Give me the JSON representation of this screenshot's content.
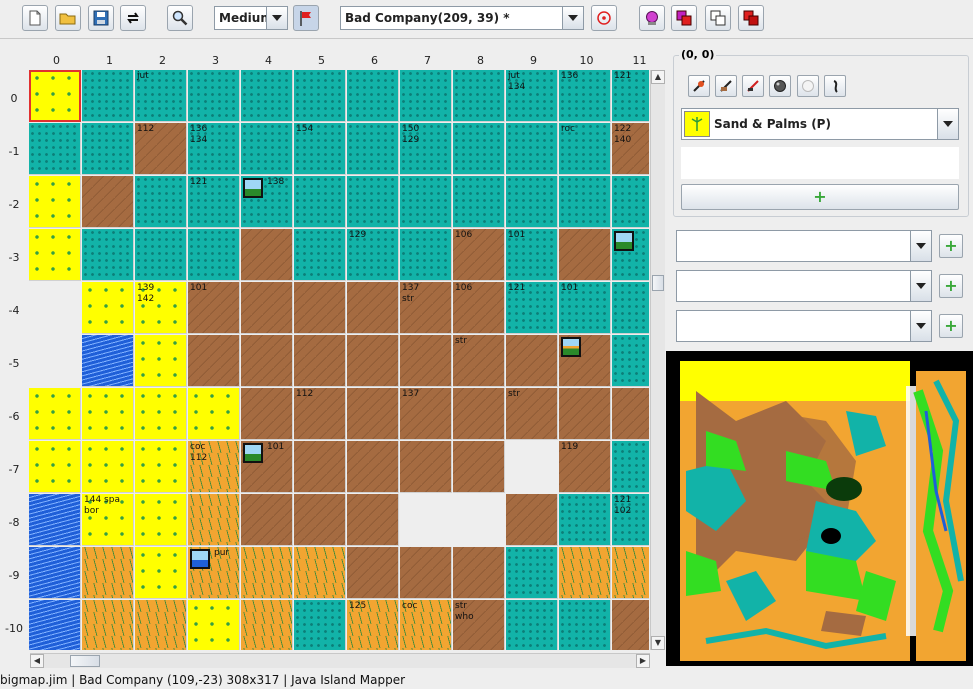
{
  "toolbar": {
    "icons": [
      "new-file-icon",
      "open-folder-icon",
      "save-icon",
      "swap-icon",
      "magnify-icon"
    ],
    "zoom_value": "Medium",
    "flag_icon": "flag-icon",
    "player_value": "Bad Company(209, 39) *",
    "target_icon": "target-icon",
    "right_icons": [
      "palette-icon",
      "layers-icon",
      "copy-layers-icon",
      "fill-icon"
    ]
  },
  "map": {
    "col_headers": [
      "0",
      "1",
      "2",
      "3",
      "4",
      "5",
      "6",
      "7",
      "8",
      "9",
      "10",
      "11"
    ],
    "row_headers": [
      "0",
      "-1",
      "-2",
      "-3",
      "-4",
      "-5",
      "-6",
      "-7",
      "-8",
      "-9",
      "-10"
    ],
    "rows": [
      [
        "sand",
        "water",
        "water",
        "water",
        "water",
        "water",
        "water",
        "water",
        "water",
        "water",
        "water",
        "water"
      ],
      [
        "water",
        "water",
        "dirt",
        "water",
        "water",
        "water",
        "water",
        "water",
        "water",
        "water",
        "water",
        "dirt"
      ],
      [
        "sand",
        "dirt",
        "water",
        "water",
        "water",
        "water",
        "water",
        "water",
        "water",
        "water",
        "water",
        "water"
      ],
      [
        "sand",
        "water",
        "water",
        "water",
        "dirt",
        "water",
        "water",
        "water",
        "dirt",
        "water",
        "dirt",
        "water"
      ],
      [
        "empty",
        "sand",
        "sand",
        "dirt",
        "dirt",
        "dirt",
        "dirt",
        "dirt",
        "dirt",
        "water",
        "water",
        "water"
      ],
      [
        "empty",
        "wave",
        "sand",
        "dirt",
        "dirt",
        "dirt",
        "dirt",
        "dirt",
        "dirt",
        "dirt",
        "dirt",
        "water"
      ],
      [
        "sand",
        "sand",
        "sand",
        "sand",
        "dirt",
        "dirt",
        "dirt",
        "dirt",
        "dirt",
        "dirt",
        "dirt",
        "dirt"
      ],
      [
        "sand",
        "sand",
        "sand",
        "orange",
        "dirt",
        "dirt",
        "dirt",
        "dirt",
        "dirt",
        "empty",
        "dirt",
        "water"
      ],
      [
        "wave",
        "sand",
        "sand",
        "orange",
        "dirt",
        "dirt",
        "dirt",
        "empty",
        "empty",
        "dirt",
        "water",
        "water"
      ],
      [
        "wave",
        "orange",
        "sand",
        "orange",
        "orange",
        "orange",
        "dirt",
        "dirt",
        "dirt",
        "water",
        "orange",
        "orange"
      ],
      [
        "wave",
        "orange",
        "orange",
        "sand",
        "orange",
        "water",
        "orange",
        "orange",
        "dirt",
        "water",
        "water",
        "dirt"
      ]
    ],
    "labels": [
      {
        "r": 0,
        "c": 2,
        "t": [
          "jut"
        ]
      },
      {
        "r": 0,
        "c": 9,
        "t": [
          "jut",
          "134"
        ]
      },
      {
        "r": 0,
        "c": 10,
        "t": [
          "136"
        ]
      },
      {
        "r": 0,
        "c": 11,
        "t": [
          "121"
        ]
      },
      {
        "r": 1,
        "c": 2,
        "t": [
          "112"
        ]
      },
      {
        "r": 1,
        "c": 3,
        "t": [
          "136",
          "134"
        ]
      },
      {
        "r": 1,
        "c": 5,
        "t": [
          "154"
        ]
      },
      {
        "r": 1,
        "c": 7,
        "t": [
          "150",
          "129"
        ]
      },
      {
        "r": 1,
        "c": 10,
        "t": [
          "roc"
        ]
      },
      {
        "r": 1,
        "c": 11,
        "t": [
          "122",
          "140"
        ]
      },
      {
        "r": 2,
        "c": 3,
        "t": [
          "121"
        ]
      },
      {
        "r": 2,
        "c": 4,
        "t": [
          "138"
        ]
      },
      {
        "r": 3,
        "c": 6,
        "t": [
          "129"
        ]
      },
      {
        "r": 3,
        "c": 8,
        "t": [
          "106"
        ]
      },
      {
        "r": 3,
        "c": 9,
        "t": [
          "101"
        ]
      },
      {
        "r": 4,
        "c": 2,
        "t": [
          "139",
          "142"
        ]
      },
      {
        "r": 4,
        "c": 3,
        "t": [
          "101"
        ]
      },
      {
        "r": 4,
        "c": 7,
        "t": [
          "137",
          "str"
        ]
      },
      {
        "r": 4,
        "c": 8,
        "t": [
          "106"
        ]
      },
      {
        "r": 4,
        "c": 9,
        "t": [
          "121"
        ]
      },
      {
        "r": 4,
        "c": 10,
        "t": [
          "101"
        ]
      },
      {
        "r": 5,
        "c": 8,
        "t": [
          "str"
        ]
      },
      {
        "r": 6,
        "c": 5,
        "t": [
          "112"
        ]
      },
      {
        "r": 6,
        "c": 7,
        "t": [
          "137"
        ]
      },
      {
        "r": 6,
        "c": 9,
        "t": [
          "str"
        ]
      },
      {
        "r": 7,
        "c": 3,
        "t": [
          "coc",
          "112"
        ]
      },
      {
        "r": 7,
        "c": 4,
        "t": [
          "101"
        ]
      },
      {
        "r": 7,
        "c": 10,
        "t": [
          "119"
        ]
      },
      {
        "r": 8,
        "c": 1,
        "t": [
          "144    spa",
          "bor"
        ]
      },
      {
        "r": 8,
        "c": 11,
        "t": [
          "121",
          "102"
        ]
      },
      {
        "r": 9,
        "c": 3,
        "t": [
          "pur"
        ]
      },
      {
        "r": 10,
        "c": 6,
        "t": [
          "125"
        ]
      },
      {
        "r": 10,
        "c": 7,
        "t": [
          "coc"
        ]
      },
      {
        "r": 10,
        "c": 8,
        "t": [
          "str",
          "who"
        ]
      }
    ],
    "objects": [
      {
        "r": 2,
        "c": 4,
        "kind": "hut"
      },
      {
        "r": 3,
        "c": 11,
        "kind": "hut"
      },
      {
        "r": 5,
        "c": 10,
        "kind": "palm-hut"
      },
      {
        "r": 7,
        "c": 4,
        "kind": "hut"
      },
      {
        "r": 9,
        "c": 3,
        "kind": "water-hut"
      }
    ]
  },
  "panel": {
    "coord": "(0, 0)",
    "tool_icons": [
      "erase-object-icon",
      "erase-terrain-icon",
      "erase-all-icon",
      "dark-sphere-icon",
      "light-sphere-icon",
      "footprint-icon"
    ],
    "terrain_value": "Sand & Palms (P)",
    "description": "",
    "add_icon": "+",
    "extra_selects": [
      "",
      "",
      ""
    ]
  },
  "status": "bigmap.jim  |  Bad Company (109,-23) 308x317  |  Java Island Mapper",
  "colors": {
    "water": "#12b3a8",
    "dirt": "#a56b41",
    "sand": "#ffff00",
    "orange": "#f2a531",
    "wave": "#1f5fd8",
    "selection": "#e03030"
  }
}
